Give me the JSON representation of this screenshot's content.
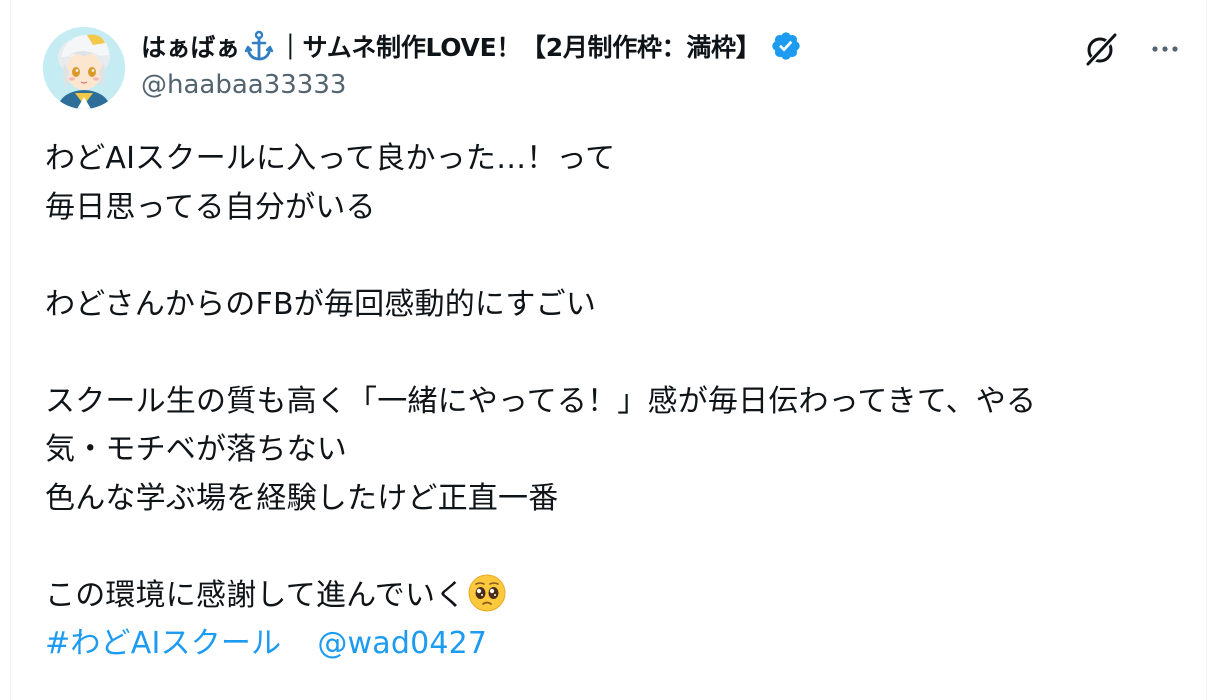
{
  "post": {
    "author": {
      "display_name_part1": "はぁばぁ",
      "anchor_emoji": "anchor-icon",
      "display_name_part2": "｜サムネ制作LOVE！【2月制作枠：満枠】",
      "handle": "@haabaa33333",
      "verified": true,
      "verified_color": "#1d9bf0"
    },
    "body": {
      "line1": "わどAIスクールに入って良かった…！って",
      "line2": "毎日思ってる自分がいる",
      "line3": "わどさんからのFBが毎回感動的にすごい",
      "line4": "スクール生の質も高く「一緒にやってる！」感が毎日伝わってきて、やる",
      "line5": "気・モチベが落ちない",
      "line6": "色んな学ぶ場を経験したけど正直一番",
      "line7": "この環境に感謝して進んでいく",
      "emoji": "pleading-face-emoji"
    },
    "hashtag": "#わどAIスクール",
    "mention": "@wad0427",
    "link_color": "#1d9bf0"
  },
  "actions": {
    "grok_icon": "grok-icon",
    "more_icon": "more-icon"
  }
}
